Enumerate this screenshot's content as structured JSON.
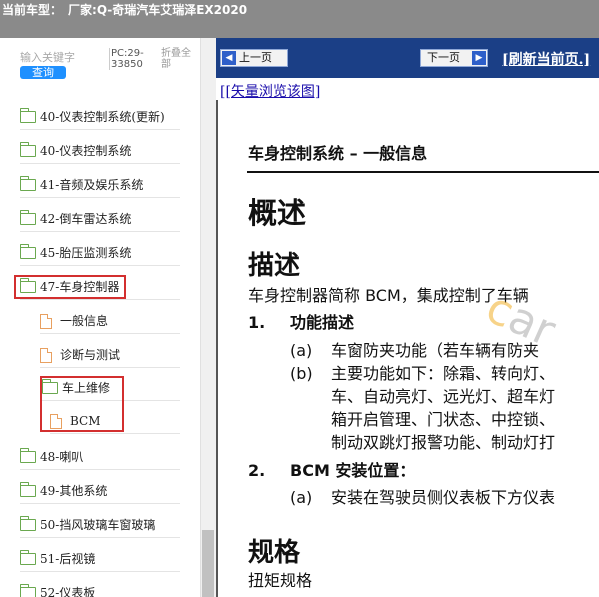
{
  "topbar": {
    "label": "当前车型：",
    "model": "厂家:Q-奇瑞汽车艾瑞泽EX2020"
  },
  "sidebar": {
    "search_placeholder": "输入关键字",
    "search_button": "查询",
    "pc_code": "PC:29-33850",
    "collapse_all": "折叠全部",
    "items": [
      {
        "label": "40-仪表控制系统(更新)",
        "type": "folder"
      },
      {
        "label": "40-仪表控制系统",
        "type": "folder"
      },
      {
        "label": "41-音频及娱乐系统",
        "type": "folder"
      },
      {
        "label": "42-倒车雷达系统",
        "type": "folder"
      },
      {
        "label": "45-胎压监测系统",
        "type": "folder"
      },
      {
        "label": "47-车身控制器",
        "type": "folder"
      },
      {
        "label": "一般信息",
        "type": "page"
      },
      {
        "label": "诊断与测试",
        "type": "page"
      },
      {
        "label": "车上维修",
        "type": "folder"
      },
      {
        "label": "BCM",
        "type": "page"
      },
      {
        "label": "48-喇叭",
        "type": "folder"
      },
      {
        "label": "49-其他系统",
        "type": "folder"
      },
      {
        "label": "50-挡风玻璃车窗玻璃",
        "type": "folder"
      },
      {
        "label": "51-后视镜",
        "type": "folder"
      },
      {
        "label": "52-仪表板",
        "type": "folder"
      }
    ]
  },
  "nav": {
    "prev": "上一页",
    "next": "下一页",
    "refresh": "[刷新当前页.]",
    "vector_link": "[[矢量浏览该图]"
  },
  "document": {
    "header": "车身控制系统 – 一般信息",
    "h_overview": "概述",
    "h_description": "描述",
    "intro": "车身控制器简称 BCM，集成控制了车辆",
    "item1_num": "1.",
    "item1_title": "功能描述",
    "item1_a_label": "(a)",
    "item1_a_text": "车窗防夹功能（若车辆有防夹",
    "item1_b_label": "(b)",
    "item1_b_lines": [
      "主要功能如下：除霜、转向灯、",
      "车、自动亮灯、远光灯、超车灯",
      "箱开启管理、门状态、中控锁、",
      "制动双跳灯报警功能、制动灯打"
    ],
    "item2_num": "2.",
    "item2_title": "BCM 安装位置：",
    "item2_a_label": "(a)",
    "item2_a_text": "安装在驾驶员侧仪表板下方仪表",
    "h_spec": "规格",
    "torque": "扭矩规格",
    "watermark": "car"
  },
  "colors": {
    "navbar": "#1b3f86",
    "highlight": "#d32f2f",
    "topbar": "#8a8a8a",
    "search_button": "#1e90ff"
  }
}
